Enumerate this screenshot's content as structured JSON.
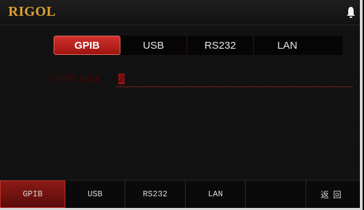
{
  "header": {
    "logo": "RIGOL",
    "alert_icon": "bell-icon"
  },
  "tabs": [
    {
      "label": "GPIB",
      "active": true
    },
    {
      "label": "USB",
      "active": false
    },
    {
      "label": "RS232",
      "active": false
    },
    {
      "label": "LAN",
      "active": false
    }
  ],
  "field": {
    "label": "GPIB Addr",
    "value": "2"
  },
  "softkeys": [
    {
      "label": "GPIB",
      "active": true
    },
    {
      "label": "USB",
      "active": false
    },
    {
      "label": "RS232",
      "active": false
    },
    {
      "label": "LAN",
      "active": false
    },
    {
      "label": "",
      "active": false
    },
    {
      "label": "返回",
      "active": false
    }
  ],
  "colors": {
    "accent": "#c8231e",
    "logo": "#e0a232"
  }
}
